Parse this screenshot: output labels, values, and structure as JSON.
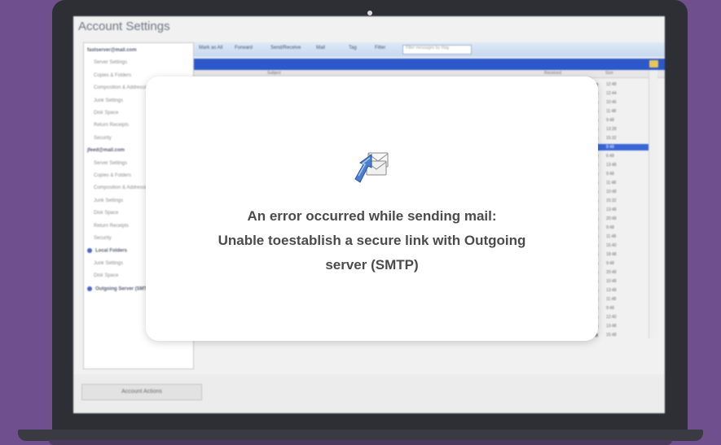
{
  "window": {
    "title": "Account Settings"
  },
  "tree": {
    "items": [
      {
        "label": "fastserver@mail.com",
        "kind": "account"
      },
      {
        "label": "Server Settings",
        "kind": "item"
      },
      {
        "label": "Copies & Folders",
        "kind": "item"
      },
      {
        "label": "Composition & Addressing",
        "kind": "item"
      },
      {
        "label": "Junk Settings",
        "kind": "item"
      },
      {
        "label": "Disk Space",
        "kind": "item"
      },
      {
        "label": "Return Receipts",
        "kind": "item"
      },
      {
        "label": "Security",
        "kind": "item"
      },
      {
        "label": "jfeed@mail.com",
        "kind": "account"
      },
      {
        "label": "Server Settings",
        "kind": "item"
      },
      {
        "label": "Copies & Folders",
        "kind": "item"
      },
      {
        "label": "Composition & Addressing",
        "kind": "item"
      },
      {
        "label": "Junk Settings",
        "kind": "item"
      },
      {
        "label": "Disk Space",
        "kind": "item"
      },
      {
        "label": "Return Receipts",
        "kind": "item"
      },
      {
        "label": "Security",
        "kind": "item"
      },
      {
        "label": "Local Folders",
        "kind": "account-bullet"
      },
      {
        "label": "Junk Settings",
        "kind": "item"
      },
      {
        "label": "Disk Space",
        "kind": "item"
      },
      {
        "label": "Outgoing Server (SMTP)",
        "kind": "account-bullet"
      }
    ]
  },
  "toolbar": {
    "items": [
      "Mark as All",
      "Forward",
      "Send/Receive",
      "Mail",
      "Tag",
      "Filter"
    ],
    "search_placeholder": "Filter messages by #tag"
  },
  "columns": [
    "Subject",
    "Received",
    "Size"
  ],
  "mail_times": [
    "12:48",
    "12:44",
    "10:46",
    "11:48",
    "9:48",
    "13:28",
    "15:32",
    "8:48",
    "6:48",
    "13:48",
    "9:48",
    "11:48",
    "10:48",
    "15:32",
    "13:48",
    "20:48",
    "9:48",
    "11:48",
    "15:40",
    "18:48",
    "9:48",
    "20:48",
    "10:48",
    "13:48",
    "11:48",
    "9:48",
    "12:40",
    "13:48",
    "15:48"
  ],
  "selected_row_index": 7,
  "bottom": {
    "account_actions": "Account Actions"
  },
  "dialog": {
    "icon": "mail-send-error-icon",
    "line1": "An error occurred while sending mail:",
    "line2": "Unable toestablish a secure link with Outgoing",
    "line3": "server (SMTP)"
  },
  "colors": {
    "background": "#6f4f8e",
    "laptop": "#2e2f35",
    "accent_blue": "#2d58c9"
  }
}
